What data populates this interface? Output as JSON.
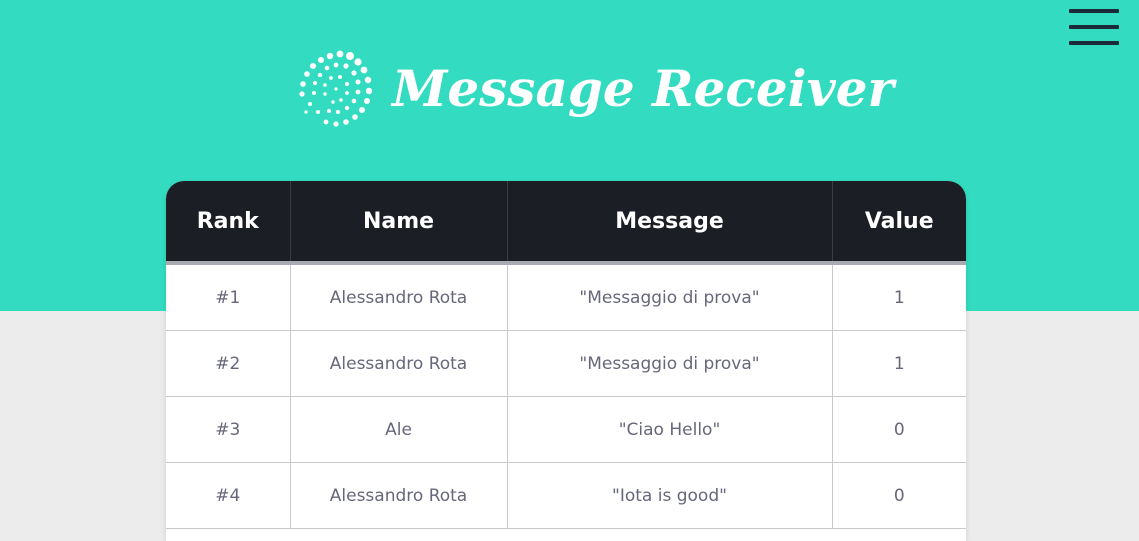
{
  "app": {
    "title": "Message Receiver",
    "logo_icon": "iota-dots-logo-icon",
    "menu_icon": "hamburger-menu-icon"
  },
  "colors": {
    "hero_background": "#33dcc1",
    "page_background": "#ececec",
    "table_header_background": "#1c1e26",
    "table_text": "#66677a"
  },
  "table": {
    "columns": [
      "Rank",
      "Name",
      "Message",
      "Value"
    ],
    "rows": [
      {
        "rank": "#1",
        "name": "Alessandro Rota",
        "message": "\"Messaggio di prova\"",
        "value": "1"
      },
      {
        "rank": "#2",
        "name": "Alessandro Rota",
        "message": "\"Messaggio di prova\"",
        "value": "1"
      },
      {
        "rank": "#3",
        "name": "Ale",
        "message": "\"Ciao Hello\"",
        "value": "0"
      },
      {
        "rank": "#4",
        "name": "Alessandro Rota",
        "message": "\"Iota is good\"",
        "value": "0"
      }
    ]
  }
}
